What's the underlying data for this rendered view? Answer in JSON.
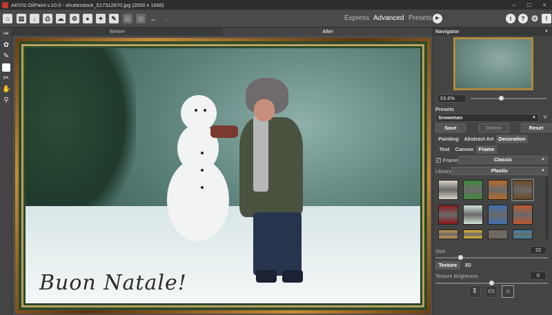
{
  "app": {
    "title": "AKVIS OilPaint v.10.0 - shutterstock_517312870.jpg (2500 x 1666)",
    "window_controls": [
      "–",
      "□",
      "×"
    ]
  },
  "toolbar": {
    "icons": [
      "home-icon",
      "open-icon",
      "save-icon",
      "print-icon",
      "share-icon",
      "batch-icon",
      "run-icon",
      "preferences-icon",
      "brush-icon",
      "undo-icon",
      "redo-icon"
    ],
    "modes": {
      "express": "Express",
      "advanced": "Advanced",
      "presets": "Presets"
    },
    "active_mode": "Advanced"
  },
  "canvas_tabs": {
    "before": "Before",
    "after": "After",
    "active": "After"
  },
  "painting": {
    "greeting": "Buon Natale!"
  },
  "navigator": {
    "title": "Navigator",
    "zoom": "53.6%"
  },
  "presets": {
    "title": "Presets",
    "selected": "Snowman",
    "save": "Save",
    "delete": "Delete",
    "reset": "Reset"
  },
  "main_tabs": [
    "Painting",
    "Abstract Art",
    "Decoration"
  ],
  "active_main_tab": "Decoration",
  "sub_tabs": [
    "Text",
    "Canvas",
    "Frame"
  ],
  "active_sub_tab": "Frame",
  "frame": {
    "checkbox_label": "Frame",
    "checked": true,
    "frame_type": "Classic",
    "library_label": "Library",
    "library_value": "Plastic",
    "size_label": "Size",
    "size_value": "22"
  },
  "texture": {
    "tabs": [
      "Texture",
      "3D"
    ],
    "active": "Texture",
    "brightness_label": "Texture Brightness",
    "brightness_value": "0"
  },
  "swatch_colors": [
    "#d8d2c4",
    "#3e8a3a",
    "#b86a2a",
    "#6b4a24",
    "#8a1a1a",
    "#cfe3d6",
    "#3f6fb0",
    "#c2582e",
    "#c8964e",
    "#e6b830",
    "#7a6a5a",
    "#3a88a8"
  ]
}
